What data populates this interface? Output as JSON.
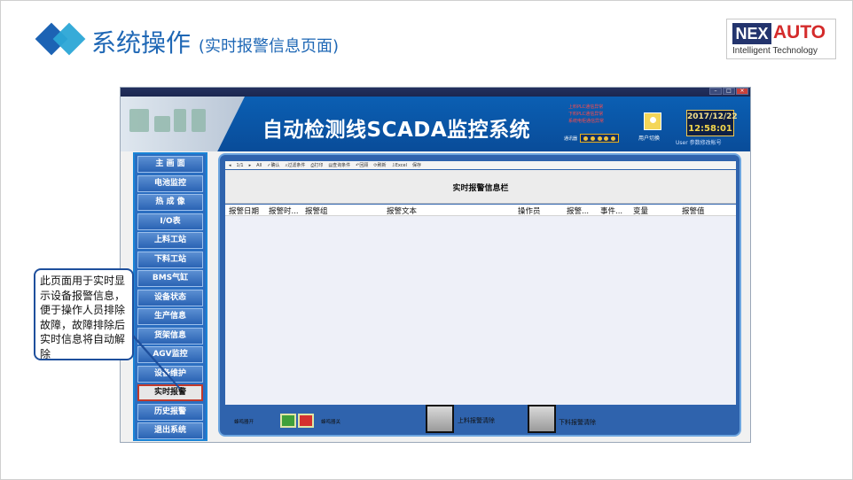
{
  "slide": {
    "title": "系统操作",
    "subtitle": "(实时报警信息页面)",
    "logo": {
      "mark": "NEX",
      "brand": "AUTO",
      "tagline": "Intelligent Technology"
    }
  },
  "scada": {
    "banner_title": "自动检测线SCADA监控系统",
    "alarm_notes": [
      "上料PLC通信异常",
      "下料PLC通信异常",
      "系统电柜通信异常"
    ],
    "comm_label": "通讯器",
    "user_switch": "用户切换",
    "clock": {
      "date": "2017/12/22",
      "time": "12:58:01"
    },
    "user_label": "User  参数修改帐号",
    "nav": [
      {
        "label": "主 画 面"
      },
      {
        "label": "电池监控"
      },
      {
        "label": "热 成 像"
      },
      {
        "label": "I/O表"
      },
      {
        "label": "上料工站"
      },
      {
        "label": "下料工站"
      },
      {
        "label": "BMS气缸"
      },
      {
        "label": "设备状态"
      },
      {
        "label": "生产信息"
      },
      {
        "label": "货架信息"
      },
      {
        "label": "AGV监控"
      },
      {
        "label": "设备维护"
      },
      {
        "label": "实时报警"
      },
      {
        "label": "历史报警"
      },
      {
        "label": "退出系统"
      }
    ],
    "toolbar": [
      "1/1",
      "All",
      "确认",
      "过滤条件",
      "打印",
      "查询条件",
      "回顾",
      "刷新",
      "Excel",
      "保存"
    ],
    "alarm_panel_title": "实时报警信息栏",
    "columns": [
      "报警日期",
      "报警时...",
      "报警组",
      "报警文本",
      "操作员",
      "报警...",
      "事件...",
      "变量",
      "报警值"
    ],
    "buzzer_on_label": "蜂鸣器开",
    "buzzer_off_label": "蜂鸣器关",
    "clear_up_label": "上料报警清除",
    "clear_down_label": "下料报警清除"
  },
  "callout": {
    "text": "此页面用于实时显示设备报警信息，便于操作人员排除故障，故障排除后实时信息将自动解除"
  },
  "colors": {
    "title_blue": "#1e67b5",
    "banner_blue": "#0b5fb3",
    "nav_blue": "#2b6ec1",
    "active_border": "#c0392b",
    "logo_red": "#d42b2b"
  }
}
